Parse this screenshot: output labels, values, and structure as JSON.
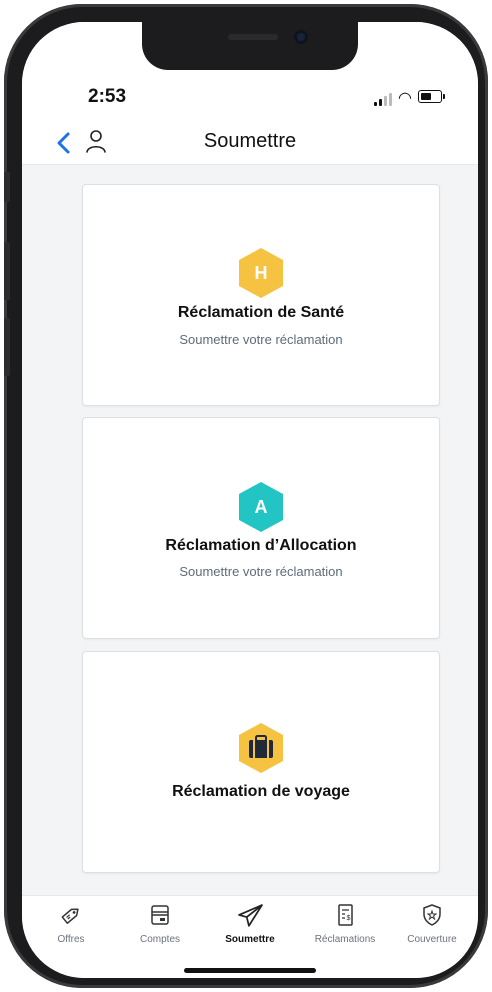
{
  "status": {
    "time": "2:53"
  },
  "header": {
    "title": "Soumettre"
  },
  "cards": [
    {
      "badge_letter": "H",
      "title": "Réclamation de Santé",
      "subtitle": "Soumettre votre réclamation",
      "color": "#F5C242"
    },
    {
      "badge_letter": "A",
      "title": "Réclamation d’Allocation",
      "subtitle": "Soumettre votre réclamation",
      "color": "#23C4C4"
    },
    {
      "badge_icon": "briefcase-icon",
      "title": "Réclamation de voyage",
      "color": "#F5C242"
    }
  ],
  "tabs": [
    {
      "label": "Offres",
      "icon": "tag-icon"
    },
    {
      "label": "Comptes",
      "icon": "card-icon"
    },
    {
      "label": "Soumettre",
      "icon": "paper-plane-icon",
      "active": true
    },
    {
      "label": "Réclamations",
      "icon": "receipt-icon"
    },
    {
      "label": "Couverture",
      "icon": "shield-icon"
    }
  ],
  "colors": {
    "accent": "#1a73e8",
    "background": "#f3f4f6",
    "card_border": "#dcdfe3"
  }
}
